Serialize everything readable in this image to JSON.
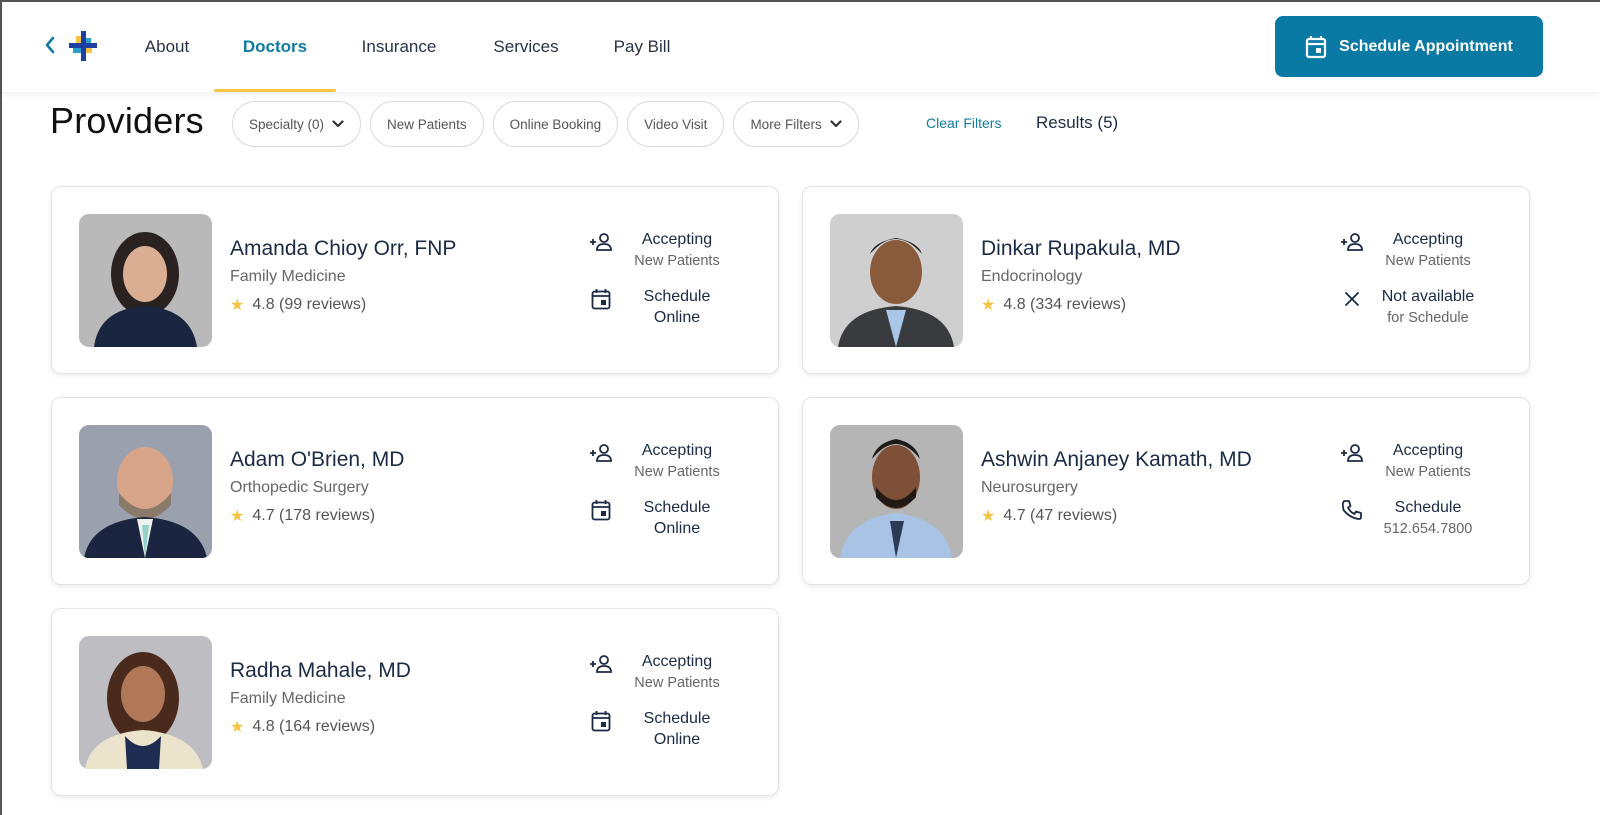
{
  "header": {
    "back_label": "Back",
    "nav": [
      {
        "label": "About",
        "active": false
      },
      {
        "label": "Doctors",
        "active": true
      },
      {
        "label": "Insurance",
        "active": false
      },
      {
        "label": "Services",
        "active": false
      },
      {
        "label": "Pay Bill",
        "active": false
      }
    ],
    "cta_label": "Schedule Appointment"
  },
  "colors": {
    "brand_blue": "#0a7aa4",
    "link_blue": "#107ba3",
    "accent_yellow": "#f6c342",
    "text_dark": "#1c2a44"
  },
  "toolbar": {
    "title": "Providers",
    "filters": [
      {
        "label": "Specialty (0)",
        "dropdown": true
      },
      {
        "label": "New Patients",
        "dropdown": false
      },
      {
        "label": "Online Booking",
        "dropdown": false
      },
      {
        "label": "Video Visit",
        "dropdown": false
      },
      {
        "label": "More Filters",
        "dropdown": true
      }
    ],
    "clear_label": "Clear Filters",
    "results_label": "Results (5)"
  },
  "providers": [
    {
      "name": "Amanda Chioy Orr, FNP",
      "specialty": "Family Medicine",
      "rating": "4.8 (99 reviews)",
      "accepting_main": "Accepting",
      "accepting_sub": "New Patients",
      "schedule_icon": "calendar-icon",
      "schedule_main": "Schedule",
      "schedule_sub": "Online"
    },
    {
      "name": "Dinkar Rupakula, MD",
      "specialty": "Endocrinology",
      "rating": "4.8 (334 reviews)",
      "accepting_main": "Accepting",
      "accepting_sub": "New Patients",
      "schedule_icon": "close-icon",
      "schedule_main": "Not available",
      "schedule_sub": "for Schedule"
    },
    {
      "name": "Adam O'Brien, MD",
      "specialty": "Orthopedic Surgery",
      "rating": "4.7 (178 reviews)",
      "accepting_main": "Accepting",
      "accepting_sub": "New Patients",
      "schedule_icon": "calendar-icon",
      "schedule_main": "Schedule",
      "schedule_sub": "Online"
    },
    {
      "name": "Ashwin Anjaney Kamath, MD",
      "specialty": "Neurosurgery",
      "rating": "4.7 (47 reviews)",
      "accepting_main": "Accepting",
      "accepting_sub": "New Patients",
      "schedule_icon": "phone-icon",
      "schedule_main": "Schedule",
      "schedule_sub": "512.654.7800"
    },
    {
      "name": "Radha Mahale, MD",
      "specialty": "Family Medicine",
      "rating": "4.8 (164 reviews)",
      "accepting_main": "Accepting",
      "accepting_sub": "New Patients",
      "schedule_icon": "calendar-icon",
      "schedule_main": "Schedule",
      "schedule_sub": "Online"
    }
  ]
}
